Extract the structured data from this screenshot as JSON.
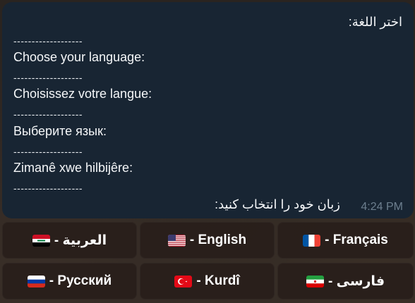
{
  "message": {
    "line_ar": "اختر اللغة:",
    "separator": "-------------------",
    "line_en": "Choose your language:",
    "line_fr": "Choisissez votre langue:",
    "line_ru": "Выберите язык:",
    "line_ku": "Zimanê xwe hilbijêre:",
    "line_fa": "زبان خود را انتخاب کنید:",
    "time": "4:24 PM"
  },
  "keyboard": {
    "rows": [
      [
        {
          "label": "العربية -",
          "flag": "iraq-flag-icon"
        },
        {
          "label": "- English",
          "flag": "us-flag-icon"
        },
        {
          "label": "- Français",
          "flag": "france-flag-icon"
        }
      ],
      [
        {
          "label": "- Русский",
          "flag": "russia-flag-icon"
        },
        {
          "label": "- Kurdî",
          "flag": "turkey-flag-icon"
        },
        {
          "label": "فارسی -",
          "flag": "iran-flag-icon"
        }
      ]
    ]
  },
  "colors": {
    "bubble": "#182533",
    "button": "#2a1f1b",
    "timestamp": "#6d7f8f"
  }
}
